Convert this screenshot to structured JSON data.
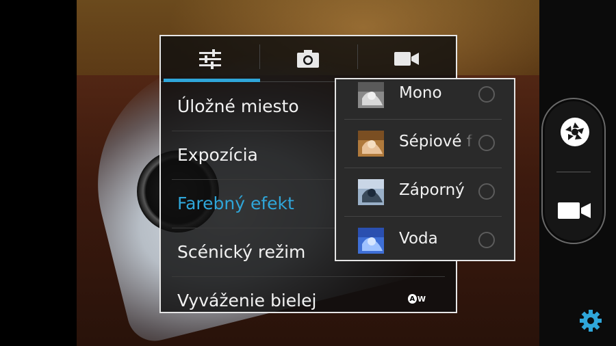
{
  "tabs": [
    {
      "icon": "sliders-icon",
      "active": true
    },
    {
      "icon": "camera-icon",
      "active": false
    },
    {
      "icon": "video-camera-icon",
      "active": false
    }
  ],
  "menu": {
    "items": [
      {
        "label": "Úložné miesto"
      },
      {
        "label": "Expozícia"
      },
      {
        "label": "Farebný efekt",
        "active": true
      },
      {
        "label": "Scénický režim"
      },
      {
        "label": "Vyváženie bielej",
        "icon": "auto-white-balance-icon",
        "icon_text": "W"
      }
    ]
  },
  "effects": {
    "items": [
      {
        "label": "Mono",
        "thumb": "mono-thumb"
      },
      {
        "label": "Sépiové f",
        "thumb": "sepia-thumb"
      },
      {
        "label": "Záporný",
        "thumb": "negative-thumb"
      },
      {
        "label": "Voda",
        "thumb": "aqua-thumb"
      }
    ]
  },
  "controls": {
    "shutter": "shutter-icon",
    "video": "video-camera-icon",
    "settings": "gear-icon"
  },
  "colors": {
    "accent": "#2fa6d9",
    "panel_border": "#e6e6e6"
  }
}
